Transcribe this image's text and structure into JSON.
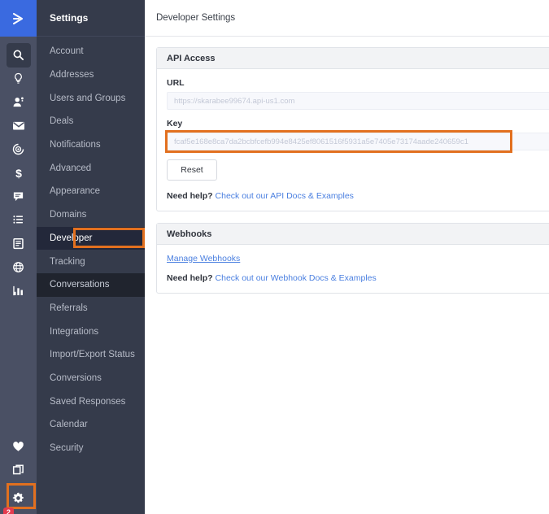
{
  "brand": {
    "logo_icon": "chevron-right-logo",
    "accent_blue": "#3a6ae0",
    "highlight_orange": "#e2701f",
    "badge_red": "#e63a4e",
    "sidebar_bg": "#353b4b",
    "rail_bg": "#4a5064",
    "link_blue": "#4a7fe0"
  },
  "rail": {
    "icons": [
      {
        "name": "search-icon",
        "active": true
      },
      {
        "name": "lightbulb-icon",
        "active": false
      },
      {
        "name": "contacts-icon",
        "active": false
      },
      {
        "name": "envelope-icon",
        "active": false
      },
      {
        "name": "automation-icon",
        "active": false
      },
      {
        "name": "dollar-icon",
        "active": false
      },
      {
        "name": "chat-icon",
        "active": false
      },
      {
        "name": "list-icon",
        "active": false
      },
      {
        "name": "form-icon",
        "active": false
      },
      {
        "name": "globe-icon",
        "active": false
      },
      {
        "name": "reports-icon",
        "active": false
      }
    ],
    "bottom_icons": [
      {
        "name": "heart-icon"
      },
      {
        "name": "apps-icon"
      }
    ],
    "settings_icon": "gear-icon",
    "badge_count": "2"
  },
  "settings_nav": {
    "header": "Settings",
    "items": [
      {
        "label": "Account",
        "state": "normal"
      },
      {
        "label": "Addresses",
        "state": "normal"
      },
      {
        "label": "Users and Groups",
        "state": "normal"
      },
      {
        "label": "Deals",
        "state": "normal"
      },
      {
        "label": "Notifications",
        "state": "normal"
      },
      {
        "label": "Advanced",
        "state": "normal"
      },
      {
        "label": "Appearance",
        "state": "normal"
      },
      {
        "label": "Domains",
        "state": "normal"
      },
      {
        "label": "Developer",
        "state": "selected"
      },
      {
        "label": "Tracking",
        "state": "normal"
      },
      {
        "label": "Conversations",
        "state": "hovered"
      },
      {
        "label": "Referrals",
        "state": "normal"
      },
      {
        "label": "Integrations",
        "state": "normal"
      },
      {
        "label": "Import/Export Status",
        "state": "normal"
      },
      {
        "label": "Conversions",
        "state": "normal"
      },
      {
        "label": "Saved Responses",
        "state": "normal"
      },
      {
        "label": "Calendar",
        "state": "normal"
      },
      {
        "label": "Security",
        "state": "normal"
      }
    ]
  },
  "main": {
    "title": "Developer Settings",
    "api_panel": {
      "heading": "API Access",
      "url_label": "URL",
      "url_value": "https://skarabee99674.api-us1.com",
      "key_label": "Key",
      "key_value": "fcaf5e168e8ca7da2bcbfcefb994e8425ef8061516f5931a5e7405e73174aade240659c1",
      "reset_button": "Reset",
      "help_prefix": "Need help?",
      "help_link": "Check out our API Docs & Examples"
    },
    "webhooks_panel": {
      "heading": "Webhooks",
      "manage_link": "Manage Webhooks",
      "help_prefix": "Need help?",
      "help_link": "Check out our Webhook Docs & Examples"
    }
  }
}
